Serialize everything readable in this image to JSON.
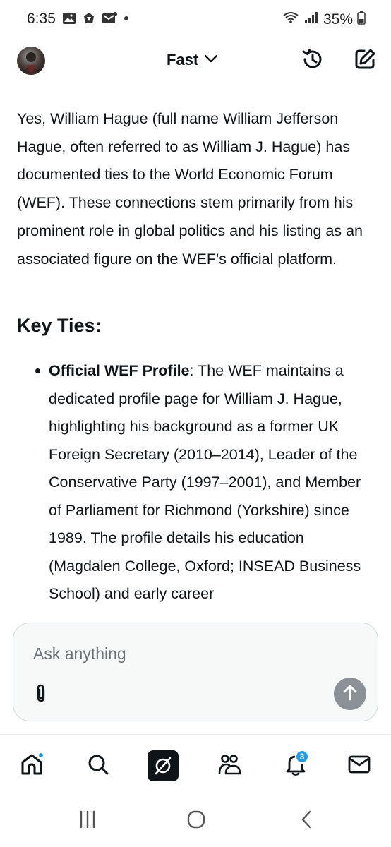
{
  "status_bar": {
    "time": "6:35",
    "battery": "35%",
    "left_icons": [
      "gallery-icon",
      "sync-icon",
      "mail-icon",
      "dot-icon"
    ],
    "right_icons": [
      "wifi-icon",
      "signal-icon",
      "battery-icon"
    ]
  },
  "header": {
    "model_label": "Fast",
    "icons": [
      "avatar",
      "chevron-down-icon",
      "history-icon",
      "compose-icon"
    ]
  },
  "message": {
    "intro": "Yes, William Hague (full name William Jefferson Hague, often referred to as William J. Hague) has documented ties to the World Economic Forum (WEF). These connections stem primarily from his prominent role in global politics and his listing as an associated figure on the WEF's official platform.",
    "heading": "Key Ties:",
    "bullets": [
      {
        "title": "Official WEF Profile",
        "text": ": The WEF maintains a dedicated profile page for William J. Hague, highlighting his background as a former UK Foreign Secretary (2010–2014), Leader of the Conservative Party (1997–2001), and Member of Parliament for Richmond (Yorkshire) since 1989. The profile details his education (Magdalen College, Oxford; INSEAD Business School) and early career"
      }
    ]
  },
  "composer": {
    "placeholder": "Ask anything",
    "icons": [
      "attach-icon",
      "send-arrow-icon"
    ]
  },
  "bottom_nav": {
    "items": [
      "home-icon",
      "search-icon",
      "grok-icon",
      "communities-icon",
      "notifications-icon",
      "messages-icon"
    ],
    "notification_count": "3"
  },
  "system_nav": {
    "items": [
      "recent-apps-icon",
      "home-circle-icon",
      "back-chevron-icon"
    ]
  },
  "colors": {
    "text": "#0f1419",
    "accent": "#1d9bf0",
    "send_button": "#8b9197",
    "composer_bg": "#f7f9f9"
  }
}
